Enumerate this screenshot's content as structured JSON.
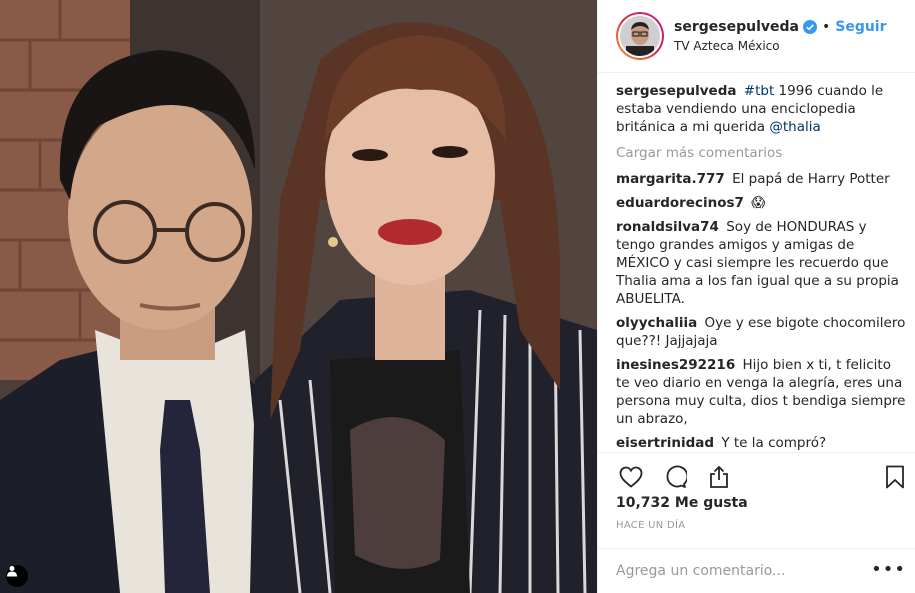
{
  "post": {
    "username": "sergesepulveda",
    "verified": true,
    "separator": "•",
    "follow_label": "Seguir",
    "location": "TV Azteca México"
  },
  "caption": {
    "user": "sergesepulveda",
    "hashtag": "#tbt",
    "text_part1": " 1996 cuando le estaba vendiendo una enciclopedia británica a mi querida ",
    "mention": "@thalia"
  },
  "load_more_label": "Cargar más comentarios",
  "comments": [
    {
      "user": "margarita.777",
      "text": "El papá de Harry Potter"
    },
    {
      "user": "eduardorecinos7",
      "text": "😱"
    },
    {
      "user": "ronaldsilva74",
      "text": "Soy de HONDURAS y tengo grandes amigos y amigas de MÉXICO y casi siempre les recuerdo que Thalia ama a los fan igual que a su propia ABUELITA."
    },
    {
      "user": "olyychaliia",
      "text": "Oye y ese bigote chocomilero que??! Jajjajaja"
    },
    {
      "user": "inesines292216",
      "text": "Hijo bien x ti, t felicito te veo diario en venga la alegría, eres una persona muy culta, dios t bendiga siempre un abrazo,"
    },
    {
      "user": "eisertrinidad",
      "text": "Y te la compró?"
    }
  ],
  "likes_label": "10,732 Me gusta",
  "time_label": "HACE UN DÍA",
  "add_comment_placeholder": "Agrega un comentario...",
  "options_label": "•••",
  "icons": {
    "like": "heart-icon",
    "comment": "comment-icon",
    "share": "share-icon",
    "save": "bookmark-icon",
    "tag": "person-tag-icon",
    "verified": "verified-badge-icon"
  },
  "colors": {
    "link": "#003569",
    "follow": "#3897f0",
    "verified": "#3897f0",
    "muted": "#999999",
    "text": "#262626"
  }
}
